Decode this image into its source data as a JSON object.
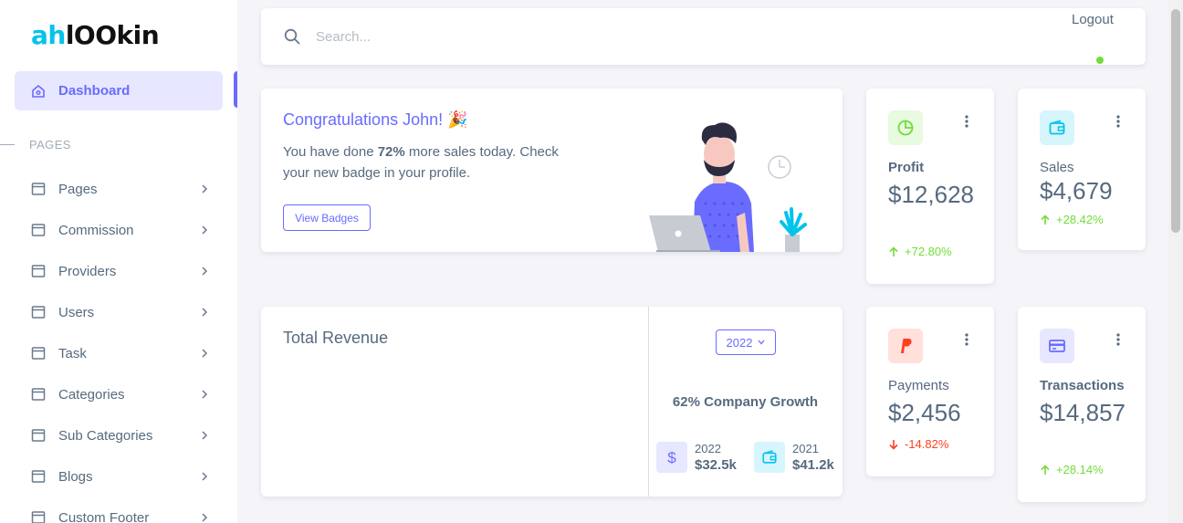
{
  "sidebar": {
    "logo_part1": "ah",
    "logo_part2": "lOOkin",
    "active_item": "Dashboard",
    "section_label": "PAGES",
    "items": [
      {
        "label": "Pages"
      },
      {
        "label": "Commission"
      },
      {
        "label": "Providers"
      },
      {
        "label": "Users"
      },
      {
        "label": "Task"
      },
      {
        "label": "Categories"
      },
      {
        "label": "Sub Categories"
      },
      {
        "label": "Blogs"
      },
      {
        "label": "Custom Footer"
      }
    ]
  },
  "topbar": {
    "search_placeholder": "Search...",
    "logout_label": "Logout"
  },
  "congrats": {
    "title": "Congratulations John! 🎉",
    "desc_prefix": "You have done ",
    "desc_highlight": "72%",
    "desc_suffix": " more sales today. Check your new badge in your profile.",
    "button_label": "View Badges"
  },
  "stats": {
    "profit": {
      "label": "Profit",
      "value": "$12,628",
      "delta": "+72.80%",
      "trend": "up",
      "icon": "pie-chart-icon",
      "color": "#71dd37"
    },
    "sales": {
      "label": "Sales",
      "value": "$4,679",
      "delta": "+28.42%",
      "trend": "up",
      "icon": "wallet-icon",
      "color": "#03c3ec"
    },
    "payments": {
      "label": "Payments",
      "value": "$2,456",
      "delta": "-14.82%",
      "trend": "down",
      "icon": "paypal-icon",
      "color": "#ff3e1d"
    },
    "transactions": {
      "label": "Transactions",
      "value": "$14,857",
      "delta": "+28.14%",
      "trend": "up",
      "icon": "credit-card-icon",
      "color": "#696cff"
    }
  },
  "revenue": {
    "title": "Total Revenue",
    "year_select": "2022",
    "growth_text": "62% Company Growth",
    "current": {
      "year": "2022",
      "amount": "$32.5k",
      "icon": "dollar-icon"
    },
    "previous": {
      "year": "2021",
      "amount": "$41.2k",
      "icon": "wallet-icon"
    }
  },
  "colors": {
    "primary": "#696cff",
    "success": "#71dd37",
    "info": "#03c3ec",
    "danger": "#ff3e1d"
  }
}
